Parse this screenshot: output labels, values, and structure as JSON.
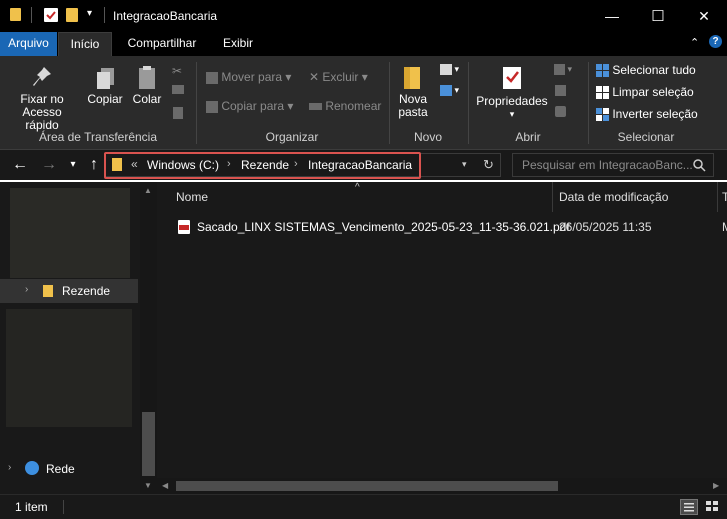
{
  "window": {
    "title": "IntegracaoBancaria",
    "minimize": "—",
    "maximize": "☐",
    "close": "✕"
  },
  "tabs": [
    {
      "label": "Arquivo"
    },
    {
      "label": "Início"
    },
    {
      "label": "Compartilhar"
    },
    {
      "label": "Exibir"
    }
  ],
  "ribbon": {
    "clipboard": {
      "pin_label_1": "Fixar no",
      "pin_label_2": "Acesso rápido",
      "copy": "Copiar",
      "paste": "Colar",
      "group": "Área de Transferência"
    },
    "organize": {
      "move_to": "Mover para",
      "copy_to": "Copiar para",
      "delete": "Excluir",
      "rename": "Renomear",
      "group": "Organizar"
    },
    "new": {
      "new_folder_1": "Nova",
      "new_folder_2": "pasta",
      "group": "Novo"
    },
    "open": {
      "properties": "Propriedades",
      "group": "Abrir"
    },
    "select": {
      "select_all": "Selecionar tudo",
      "clear": "Limpar seleção",
      "invert": "Inverter seleção",
      "group": "Selecionar"
    }
  },
  "address": {
    "overflow": "«",
    "crumbs": [
      "Windows (C:)",
      "Rezende",
      "IntegracaoBancaria"
    ],
    "search_placeholder": "Pesquisar em IntegracaoBanc..."
  },
  "nav": {
    "rezende": "Rezende",
    "network": "Rede"
  },
  "columns": {
    "name": "Nome",
    "modified": "Data de modificação",
    "type": "T"
  },
  "files": [
    {
      "name": "Sacado_LINX SISTEMAS_Vencimento_2025-05-23_11-35-36.021.pdf",
      "modified": "26/05/2025 11:35",
      "type": "M"
    }
  ],
  "status": {
    "count": "1 item"
  },
  "colors": {
    "accent_file_tab": "#1a67b5",
    "highlight": "#d9534f",
    "folder": "#f0c14b"
  }
}
